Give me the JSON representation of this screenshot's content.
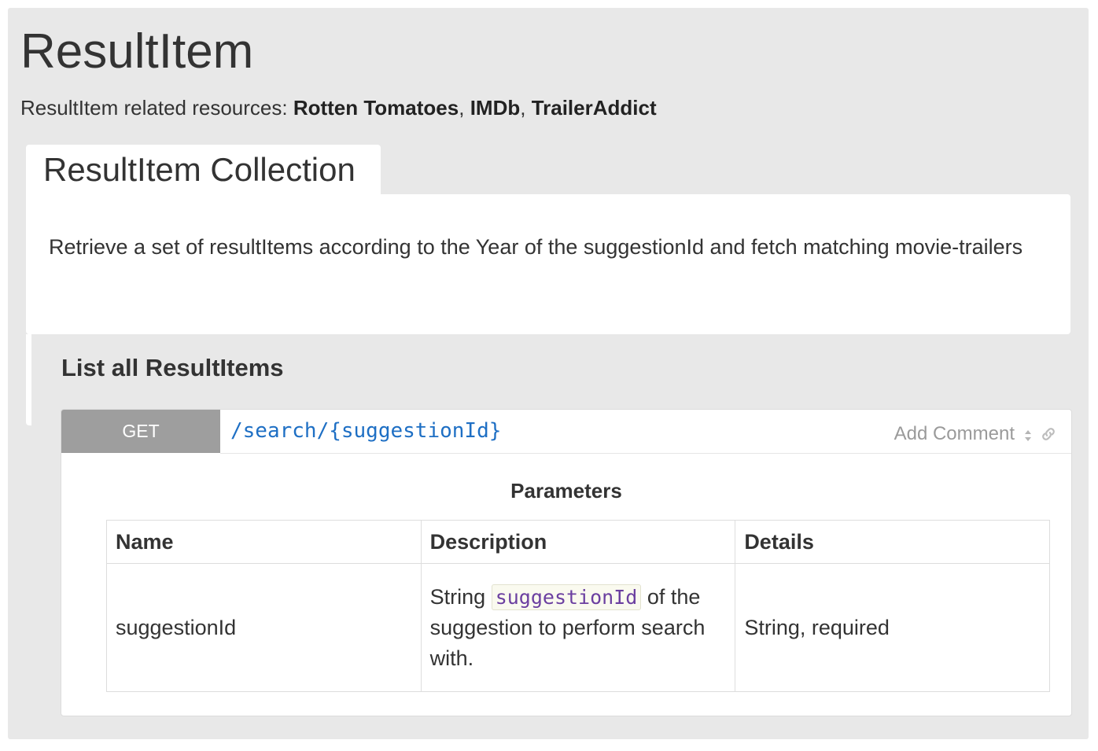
{
  "page": {
    "title": "ResultItem",
    "related_prefix": "ResultItem related resources: ",
    "related_links": [
      "Rotten Tomatoes",
      "IMDb",
      "TrailerAddict"
    ],
    "related_separator": ", "
  },
  "collection": {
    "title": "ResultItem Collection",
    "description": "Retrieve a set of resultItems according to the Year of the suggestionId and fetch matching movie-trailers"
  },
  "action": {
    "title": "List all ResultItems",
    "method": "GET",
    "uri": "/search/{suggestionId}",
    "add_comment_label": "Add Comment",
    "parameters": {
      "heading": "Parameters",
      "columns": [
        "Name",
        "Description",
        "Details"
      ],
      "rows": [
        {
          "name": "suggestionId",
          "description_prefix": "String ",
          "description_code": "suggestionId",
          "description_suffix": " of the suggestion to perform search with.",
          "details": "String, required"
        }
      ]
    }
  },
  "icons": {
    "sort": "sort-icon",
    "link": "link-icon"
  },
  "colors": {
    "background": "#e8e8e8",
    "panel": "#ffffff",
    "method_badge": "#9e9e9e",
    "uri": "#1e6fc4",
    "code_text": "#6b3fa0",
    "muted": "#9a9a9a"
  }
}
